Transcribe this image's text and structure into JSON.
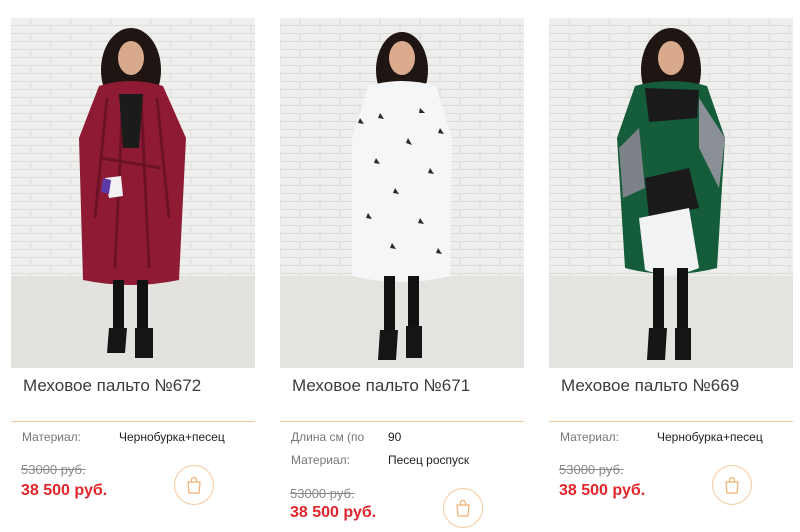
{
  "colors": {
    "accent": "#f0c8a0",
    "price_new": "#e0262b",
    "price_old": "#8a8a8a"
  },
  "products": [
    {
      "title": "Меховое пальто №672",
      "image_icon": "coat-photo-burgundy",
      "props": [
        {
          "label": "Материал:",
          "value": "Чернобурка+песец"
        }
      ],
      "old_price": "53000 руб.",
      "price": "38 500 руб.",
      "cart_icon": "shopping-bag-icon"
    },
    {
      "title": "Меховое пальто №671",
      "image_icon": "coat-photo-white-spotted",
      "props": [
        {
          "label": "Длина см (по",
          "value": "90"
        },
        {
          "label": "Материал:",
          "value": "Песец роспуск"
        }
      ],
      "old_price": "53000 руб.",
      "price": "38 500 руб.",
      "cart_icon": "shopping-bag-icon"
    },
    {
      "title": "Меховое пальто №669",
      "image_icon": "coat-photo-green",
      "props": [
        {
          "label": "Материал:",
          "value": "Чернобурка+песец"
        }
      ],
      "old_price": "53000 руб.",
      "price": "38 500 руб.",
      "cart_icon": "shopping-bag-icon"
    }
  ]
}
